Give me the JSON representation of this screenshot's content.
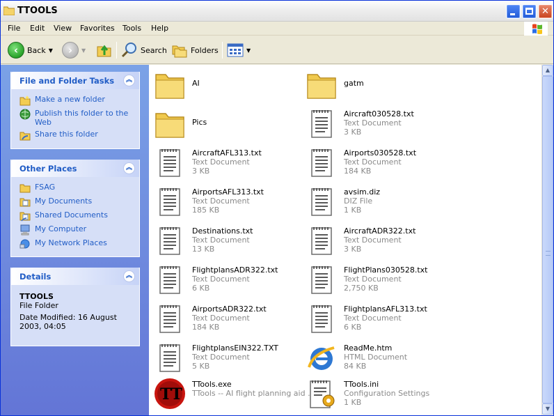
{
  "window": {
    "title": "TTOOLS"
  },
  "menu": [
    "File",
    "Edit",
    "View",
    "Favorites",
    "Tools",
    "Help"
  ],
  "toolbar": {
    "back": "Back",
    "search": "Search",
    "folders": "Folders"
  },
  "panels": {
    "file_tasks": {
      "title": "File and Folder Tasks",
      "items": [
        {
          "label": "Make a new folder",
          "icon": "new-folder-icon"
        },
        {
          "label": "Publish this folder to the Web",
          "icon": "publish-web-icon"
        },
        {
          "label": "Share this folder",
          "icon": "share-folder-icon"
        }
      ]
    },
    "other_places": {
      "title": "Other Places",
      "items": [
        {
          "label": "FSAG",
          "icon": "folder-icon"
        },
        {
          "label": "My Documents",
          "icon": "my-documents-icon"
        },
        {
          "label": "Shared Documents",
          "icon": "shared-documents-icon"
        },
        {
          "label": "My Computer",
          "icon": "my-computer-icon"
        },
        {
          "label": "My Network Places",
          "icon": "network-places-icon"
        }
      ]
    },
    "details": {
      "title": "Details",
      "name": "TTOOLS",
      "type": "File Folder",
      "modified": "Date Modified: 16 August 2003, 04:05"
    }
  },
  "files": [
    {
      "name": "AI",
      "type": "",
      "size": "",
      "icon": "folder"
    },
    {
      "name": "gatm",
      "type": "",
      "size": "",
      "icon": "folder"
    },
    {
      "name": "Pics",
      "type": "",
      "size": "",
      "icon": "folder"
    },
    {
      "name": "Aircraft030528.txt",
      "type": "Text Document",
      "size": "3 KB",
      "icon": "text"
    },
    {
      "name": "AircraftAFL313.txt",
      "type": "Text Document",
      "size": "3 KB",
      "icon": "text"
    },
    {
      "name": "Airports030528.txt",
      "type": "Text Document",
      "size": "184 KB",
      "icon": "text"
    },
    {
      "name": "AirportsAFL313.txt",
      "type": "Text Document",
      "size": "185 KB",
      "icon": "text"
    },
    {
      "name": "avsim.diz",
      "type": "DIZ File",
      "size": "1 KB",
      "icon": "text"
    },
    {
      "name": "Destinations.txt",
      "type": "Text Document",
      "size": "13 KB",
      "icon": "text"
    },
    {
      "name": "AircraftADR322.txt",
      "type": "Text Document",
      "size": "3 KB",
      "icon": "text"
    },
    {
      "name": "FlightplansADR322.txt",
      "type": "Text Document",
      "size": "6 KB",
      "icon": "text"
    },
    {
      "name": "FlightPlans030528.txt",
      "type": "Text Document",
      "size": "2,750 KB",
      "icon": "text"
    },
    {
      "name": "AirportsADR322.txt",
      "type": "Text Document",
      "size": "184 KB",
      "icon": "text"
    },
    {
      "name": "FlightplansAFL313.txt",
      "type": "Text Document",
      "size": "6 KB",
      "icon": "text"
    },
    {
      "name": "FlightplansEIN322.TXT",
      "type": "Text Document",
      "size": "5 KB",
      "icon": "text"
    },
    {
      "name": "ReadMe.htm",
      "type": "HTML Document",
      "size": "84 KB",
      "icon": "ie"
    },
    {
      "name": "TTools.exe",
      "type": "TTools -- AI flight planning aid ...",
      "size": "",
      "icon": "exe"
    },
    {
      "name": "TTools.ini",
      "type": "Configuration Settings",
      "size": "1 KB",
      "icon": "ini"
    }
  ]
}
